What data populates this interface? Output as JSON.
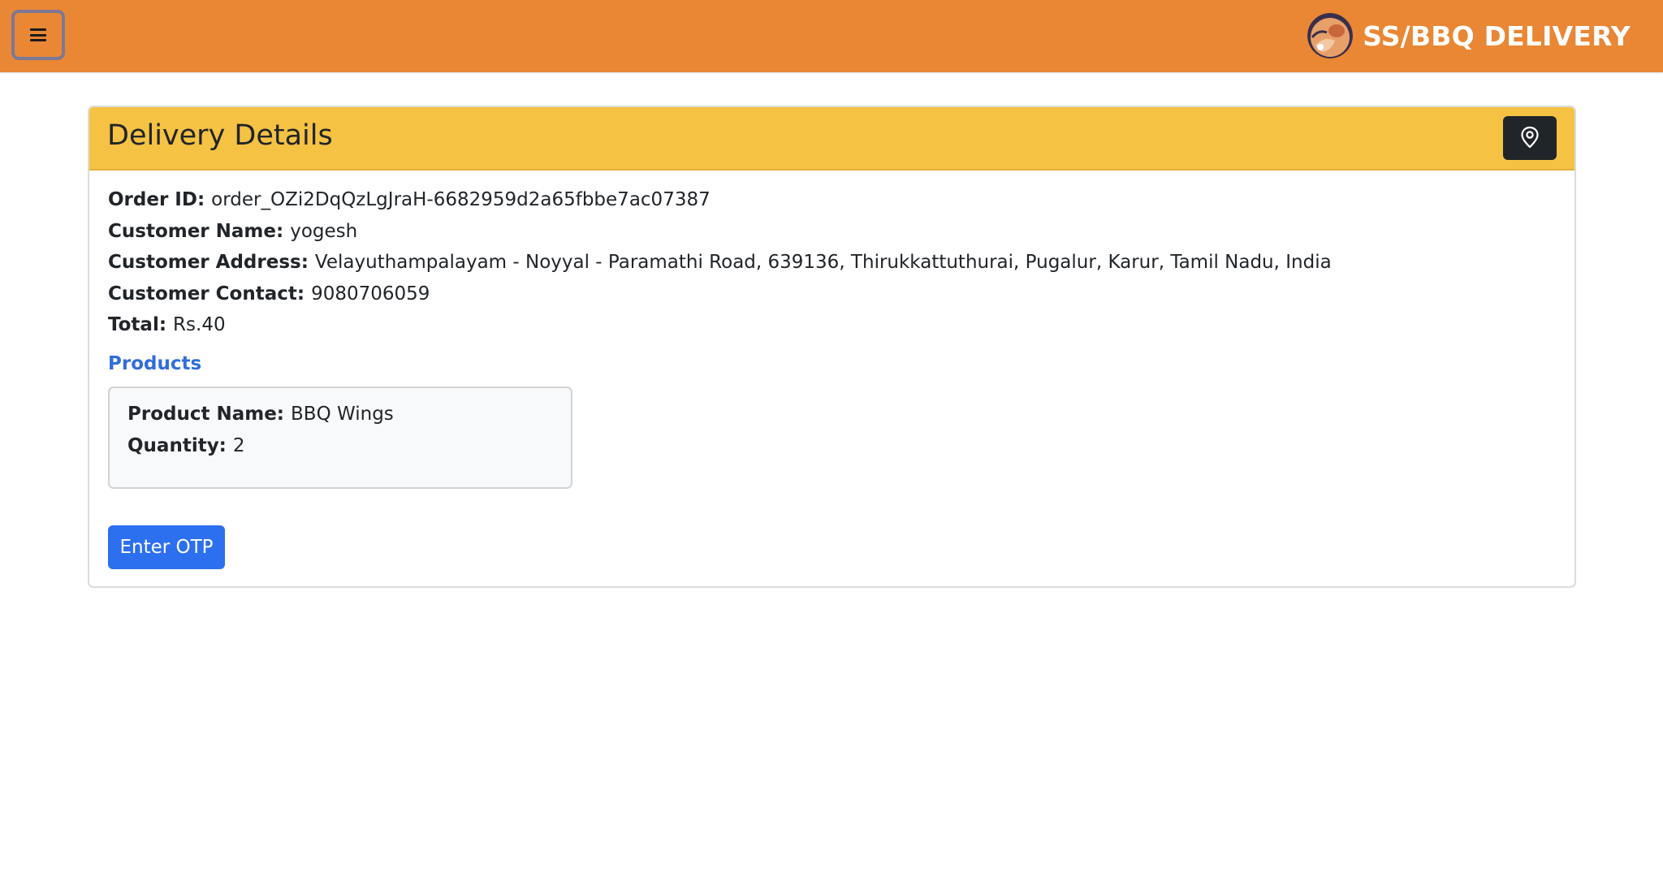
{
  "navbar": {
    "menu_icon": "hamburger-menu-icon",
    "brand_logo": "bbq-logo",
    "brand_text": "SS/BBQ DELIVERY",
    "background_color": "#e98734"
  },
  "card": {
    "title": "Delivery Details",
    "map_icon": "map-pin-icon",
    "header_color": "#f5c244",
    "fields": {
      "order_id": {
        "label": "Order ID:",
        "value": "order_OZi2DqQzLgJraH-6682959d2a65fbbe7ac07387"
      },
      "customer_name": {
        "label": "Customer Name:",
        "value": "yogesh"
      },
      "customer_address": {
        "label": "Customer Address:",
        "value": "Velayuthampalayam - Noyyal - Paramathi Road, 639136, Thirukkattuthurai, Pugalur, Karur, Tamil Nadu, India"
      },
      "customer_contact": {
        "label": "Customer Contact:",
        "value": "9080706059"
      },
      "total": {
        "label": "Total:",
        "value": "Rs.40"
      }
    },
    "products": {
      "heading": "Products",
      "items": [
        {
          "name_label": "Product Name:",
          "name": "BBQ Wings",
          "quantity_label": "Quantity:",
          "quantity": "2"
        }
      ]
    },
    "otp_button_label": "Enter OTP",
    "accent_color": "#2c6fef"
  }
}
